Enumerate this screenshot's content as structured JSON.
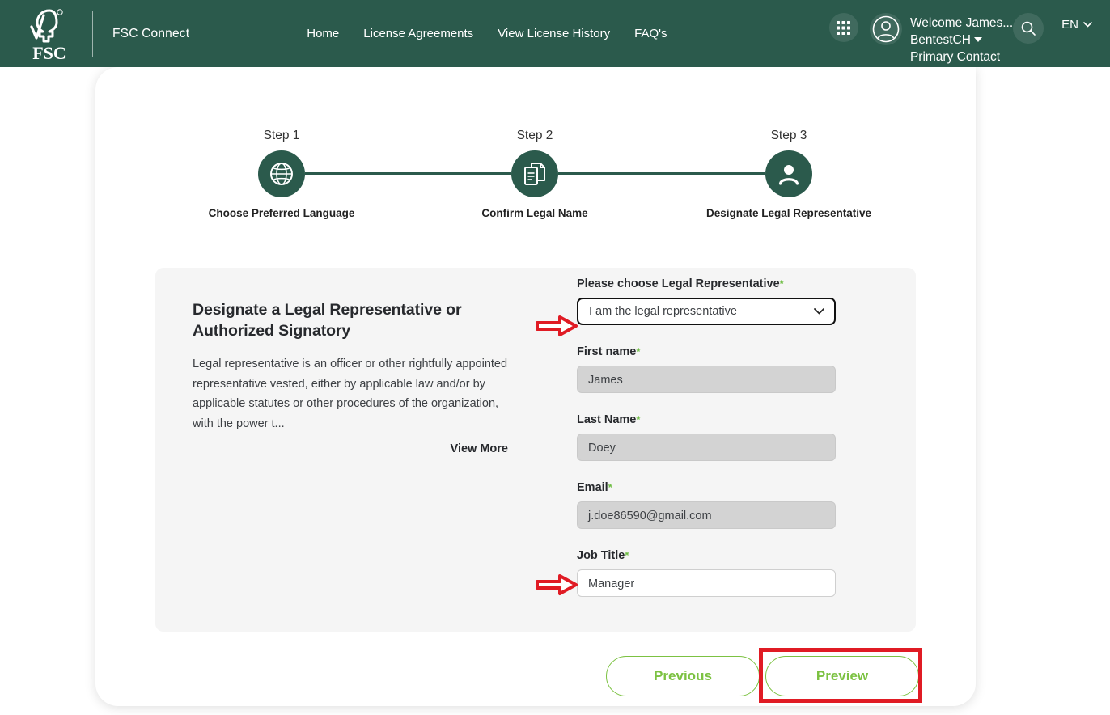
{
  "header": {
    "logo_alt": "FSC",
    "logo_mark": "FSC",
    "brand_name": "FSC Connect",
    "nav": [
      {
        "label": "Home"
      },
      {
        "label": "License Agreements"
      },
      {
        "label": "View License History"
      },
      {
        "label": "FAQ's"
      }
    ],
    "apps_icon": "grid-apps-icon",
    "avatar_icon": "user-avatar-icon",
    "search_icon": "search-icon",
    "user": {
      "line1": "Welcome James...",
      "line2": "BentestCH",
      "line3": "Primary Contact"
    },
    "language": {
      "value": "EN",
      "chevron": "chevron-down-icon"
    }
  },
  "stepper": {
    "steps": [
      {
        "number": "Step 1",
        "label": "Choose Preferred Language",
        "icon": "globe-icon",
        "state": "complete"
      },
      {
        "number": "Step 2",
        "label": "Confirm Legal Name",
        "icon": "documents-icon",
        "state": "complete"
      },
      {
        "number": "Step 3",
        "label": "Designate Legal Representative",
        "icon": "person-icon",
        "state": "active"
      }
    ]
  },
  "panel": {
    "title": "Designate a Legal Representative or Authorized Signatory",
    "description": "Legal representative is an officer or other rightfully appointed representative vested, either by applicable law and/or by applicable statutes or other procedures of the organization, with the power t...",
    "view_more_label": "View More"
  },
  "form": {
    "required_marker": "*",
    "fields": [
      {
        "name": "legal-representative-select",
        "label": "Please choose Legal Representative",
        "required": true,
        "type": "select",
        "value": "I am the legal representative",
        "readonly": false,
        "highlighted": true
      },
      {
        "name": "first-name",
        "label": "First name",
        "required": true,
        "type": "text",
        "value": "James",
        "readonly": true,
        "highlighted": false
      },
      {
        "name": "last-name",
        "label": "Last Name",
        "required": true,
        "type": "text",
        "value": "Doey",
        "readonly": true,
        "highlighted": false
      },
      {
        "name": "email",
        "label": "Email",
        "required": true,
        "type": "text",
        "value": "j.doe86590@gmail.com",
        "readonly": true,
        "highlighted": false
      },
      {
        "name": "job-title",
        "label": "Job Title",
        "required": true,
        "type": "text",
        "value": "Manager",
        "readonly": false,
        "highlighted": true
      }
    ]
  },
  "buttons": {
    "previous_label": "Previous",
    "preview_label": "Preview"
  },
  "annotations": {
    "arrow_color": "#e01b24",
    "highlight_color": "#e01b24",
    "arrow_targets": [
      "legal-representative-select",
      "job-title"
    ],
    "highlight_target": "preview-button"
  },
  "colors": {
    "brand_green": "#2b5a4c",
    "accent_green": "#7cc242",
    "required_green": "#6fbe44",
    "panel_gray": "#f5f5f5",
    "readonly_gray": "#d3d3d3",
    "annotation_red": "#e01b24"
  }
}
